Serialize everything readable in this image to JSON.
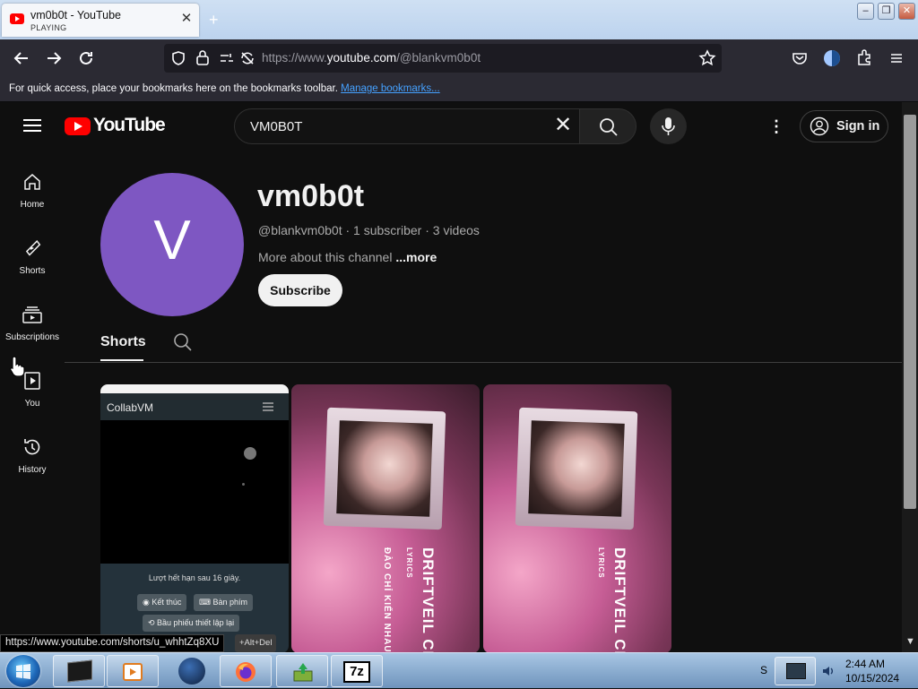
{
  "browser": {
    "tab": {
      "title": "vm0b0t - YouTube",
      "status": "PLAYING"
    },
    "new_tab": "+",
    "url_prefix": "https://www.",
    "url_host": "youtube.com",
    "url_path": "/@blankvm0b0t",
    "bookmarks_prompt": "For quick access, place your bookmarks here on the bookmarks toolbar.",
    "bookmarks_link": "Manage bookmarks..."
  },
  "youtube": {
    "logo_text": "YouTube",
    "search_query": "VM0B0T",
    "sign_in_label": "Sign in",
    "sidebar": [
      {
        "label": "Home",
        "icon": "home-icon"
      },
      {
        "label": "Shorts",
        "icon": "shorts-icon"
      },
      {
        "label": "Subscriptions",
        "icon": "subscriptions-icon"
      },
      {
        "label": "You",
        "icon": "you-icon"
      },
      {
        "label": "History",
        "icon": "history-icon"
      }
    ],
    "channel": {
      "avatar_letter": "V",
      "avatar_color": "#7e57c2",
      "name": "vm0b0t",
      "handle": "@blankvm0b0t",
      "subscribers": "1 subscriber",
      "videos": "3 videos",
      "about_prefix": "More about this channel",
      "about_more": "...more",
      "subscribe_label": "Subscribe"
    },
    "tabs": {
      "active": "Shorts"
    },
    "shorts": [
      {
        "header": "CollabVM",
        "timer_text": "Lượt hết hạn sau 16 giây.",
        "buttons": [
          "Kết thúc",
          "Bàn phím"
        ],
        "reset_button": "Bầu phiếu thiết lập lại"
      },
      {
        "vertical_title": "DRIFTVEIL CITY X",
        "vertical_sub": "ĐÀO CHỈ KIỂN NHAU ĐẦU TRANG",
        "tag": "LYRICS"
      },
      {
        "vertical_title": "DRIFTVEIL CITY X",
        "tag": "LYRICS"
      }
    ]
  },
  "status_bar": {
    "link": "https://www.youtube.com/shorts/u_whhtZq8XU",
    "shortcut": "+Alt+Del"
  },
  "taskbar": {
    "time": "2:44 AM",
    "date": "10/15/2024",
    "tray_letter": "S",
    "items": [
      "terminal-icon",
      "media-player-icon",
      "globe-icon",
      "firefox-icon",
      "installer-icon",
      "7zip-icon"
    ]
  },
  "colors": {
    "yt_red": "#ff0000",
    "page_bg": "#0f0f0f",
    "link_blue": "#45a1ff"
  }
}
